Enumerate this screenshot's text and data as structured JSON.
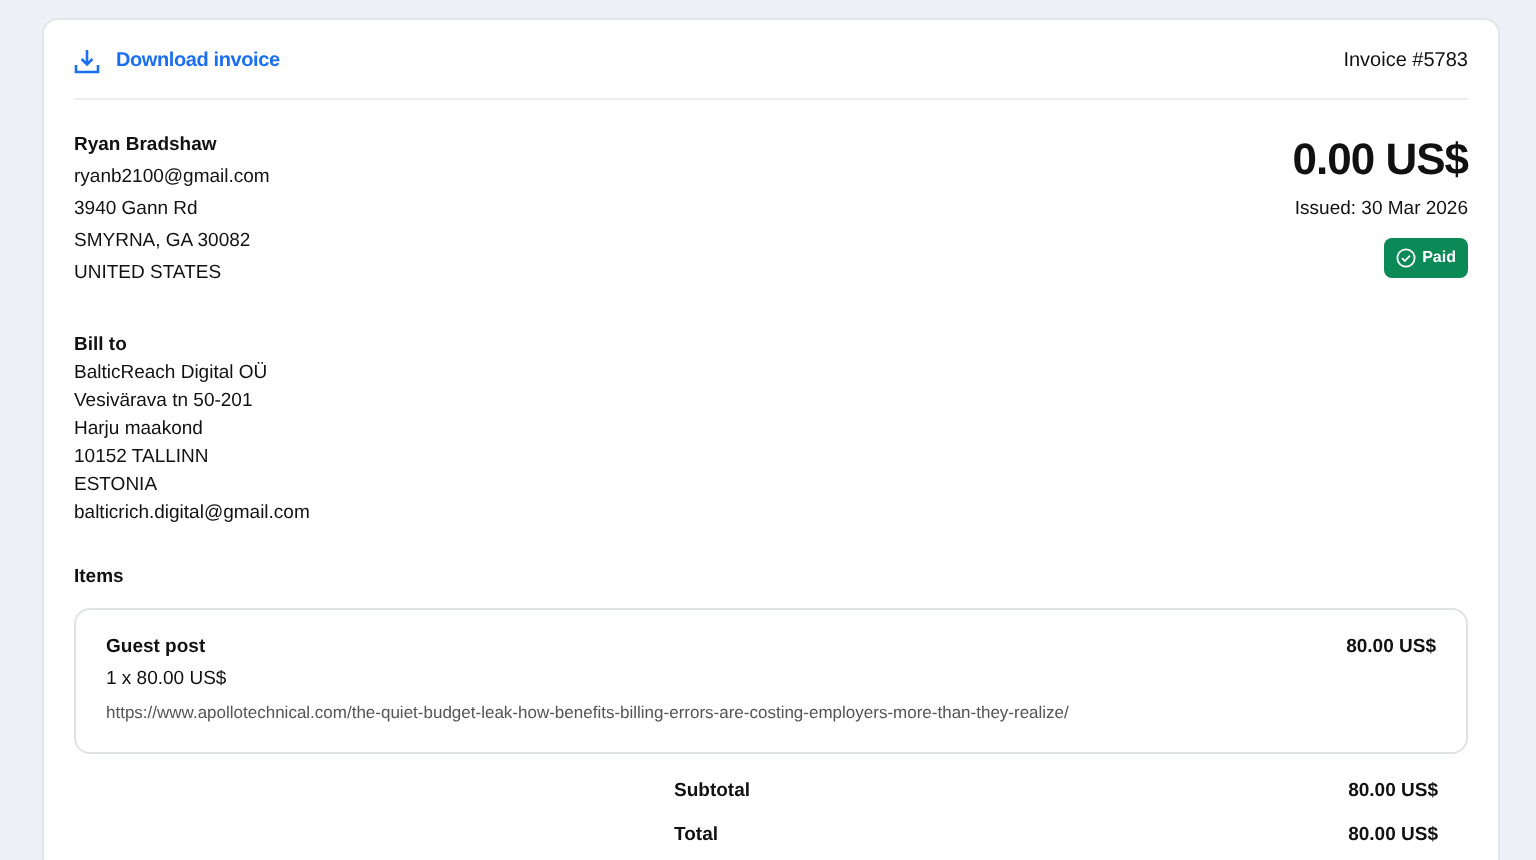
{
  "header": {
    "download_link": "Download invoice",
    "invoice_number": "Invoice #5783"
  },
  "sender": {
    "name": "Ryan Bradshaw",
    "lines": [
      "ryanb2100@gmail.com",
      "3940 Gann Rd",
      "SMYRNA, GA 30082",
      "UNITED STATES"
    ]
  },
  "summary": {
    "amount": "0.00 US$",
    "issued": "Issued: 30 Mar 2026",
    "status": {
      "label": "Paid",
      "kind": "paid"
    }
  },
  "bill_to": {
    "heading": "Bill to",
    "lines": [
      "BalticReach Digital OÜ",
      "Vesivärava tn 50-201",
      "Harju maakond",
      "10152 TALLINN",
      "ESTONIA",
      "balticrich.digital@gmail.com"
    ]
  },
  "items": {
    "heading": "Items",
    "rows": [
      {
        "name": "Guest post",
        "amount": "80.00 US$",
        "quantity": "1 x 80.00 US$",
        "description": "https://www.apollotechnical.com/the-quiet-budget-leak-how-benefits-billing-errors-are-costing-employers-more-than-they-realize/"
      }
    ]
  },
  "totals": [
    {
      "label": "Subtotal",
      "value": "80.00 US$"
    },
    {
      "label": "Total",
      "value": "80.00 US$"
    }
  ]
}
